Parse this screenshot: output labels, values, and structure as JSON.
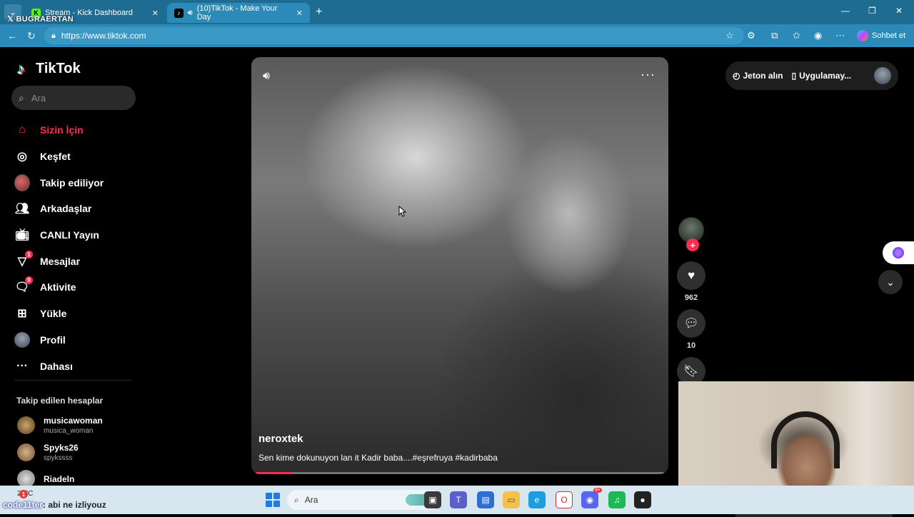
{
  "browser": {
    "tabs": [
      {
        "label": "Stream - Kick Dashboard",
        "favicon": "K",
        "favicon_color": "#53fc18",
        "active": false
      },
      {
        "label": "(10)TikTok - Make Your Day",
        "favicon": "♪",
        "favicon_color": "#000000",
        "active": true
      }
    ],
    "url": "https://www.tiktok.com",
    "copilot_label": "Sohbet et",
    "overlay_brand": "BUGRAERTAN"
  },
  "sidebar": {
    "logo_text": "TikTok",
    "search_placeholder": "Ara",
    "nav": [
      {
        "label": "Sizin İçin",
        "icon": "home-icon"
      },
      {
        "label": "Keşfet",
        "icon": "compass-icon"
      },
      {
        "label": "Takip ediliyor",
        "icon": "following-avatar"
      },
      {
        "label": "Arkadaşlar",
        "icon": "friends-icon"
      },
      {
        "label": "CANLI Yayın",
        "icon": "live-tv-icon"
      },
      {
        "label": "Mesajlar",
        "icon": "messages-icon",
        "badge": "1"
      },
      {
        "label": "Aktivite",
        "icon": "activity-icon",
        "badge": "9"
      },
      {
        "label": "Yükle",
        "icon": "upload-icon"
      },
      {
        "label": "Profil",
        "icon": "profile-avatar"
      },
      {
        "label": "Dahası",
        "icon": "more-dots-icon"
      }
    ],
    "following_title": "Takip edilen hesaplar",
    "following": [
      {
        "name": "musicawoman",
        "username": "musica_woman"
      },
      {
        "name": "Spyks26",
        "username": "spykssss"
      },
      {
        "name": "Riadeln",
        "username": ""
      }
    ]
  },
  "video": {
    "author": "neroxtek",
    "caption": "Sen kime dokunuyon lan it Kadir baba....#eşrefruya #kadirbaba",
    "progress": 0.09
  },
  "actions": {
    "likes": "962",
    "comments": "10"
  },
  "header": {
    "coins_label": "Jeton alın",
    "app_label": "Uygulamay..."
  },
  "taskbar": {
    "temperature": "21°C",
    "search_placeholder": "Ara",
    "notification_count": "1",
    "chat_user": "code11ter",
    "chat_message": ": abi ne izliyouz",
    "discord_badge": "9+"
  },
  "colors": {
    "accent": "#fe2c55",
    "tabbar": "#1f6c93",
    "addressbar": "#2b8ab8"
  }
}
